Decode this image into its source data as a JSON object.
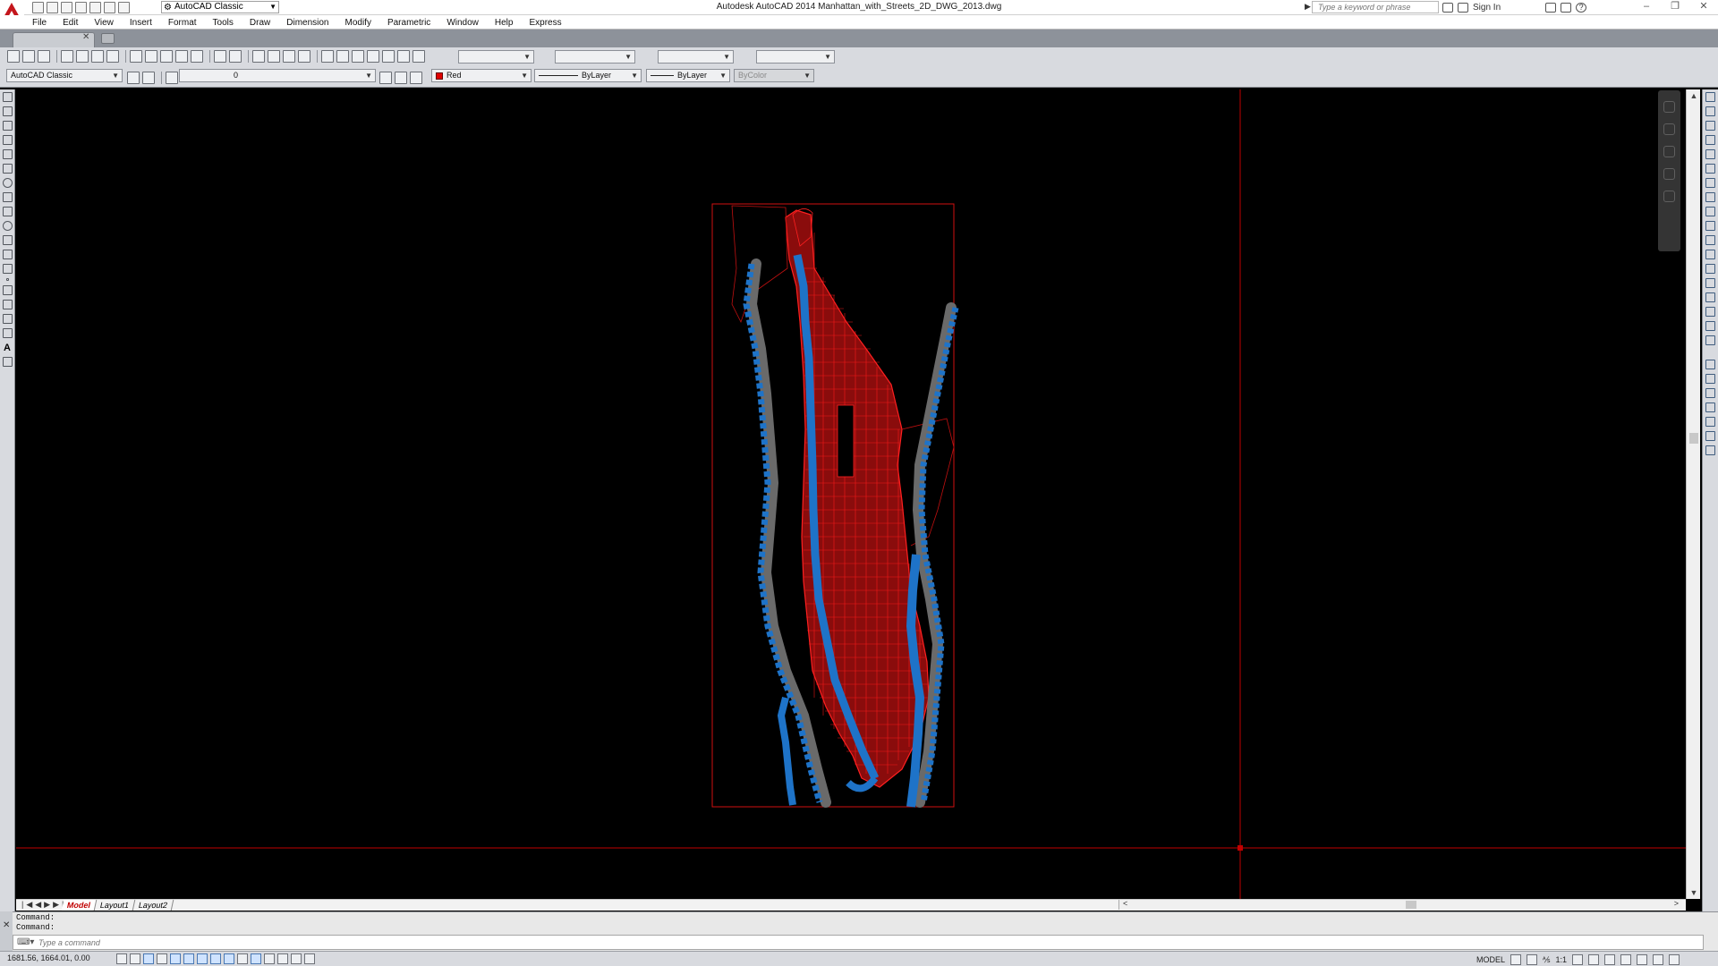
{
  "window": {
    "title": "Autodesk AutoCAD 2014    Manhattan_with_Streets_2D_DWG_2013.dwg",
    "workspace": "AutoCAD Classic",
    "search_placeholder": "Type a keyword or phrase",
    "sign_in": "Sign In",
    "help": "?"
  },
  "menu": [
    "File",
    "Edit",
    "View",
    "Insert",
    "Format",
    "Tools",
    "Draw",
    "Dimension",
    "Modify",
    "Parametric",
    "Window",
    "Help",
    "Express"
  ],
  "toolbar": {
    "workspace_combo": "AutoCAD Classic",
    "layer_combo": "0",
    "color_combo": "Red",
    "linetype_combo": "ByLayer",
    "lineweight_combo": "ByLayer",
    "plotstyle_combo": "ByColor"
  },
  "layout_tabs": [
    "Model",
    "Layout1",
    "Layout2"
  ],
  "active_layout": "Model",
  "command": {
    "history": [
      "Command:",
      "Command:"
    ],
    "placeholder": "Type a command"
  },
  "status": {
    "coordinates": "1681.56, 1664.01, 0.00",
    "space": "MODEL",
    "scale": "1:1"
  },
  "colors": {
    "drawing_bg": "#000000",
    "streets": "#e01010",
    "water": "#1e73c8",
    "shore": "#6a6a6a"
  }
}
